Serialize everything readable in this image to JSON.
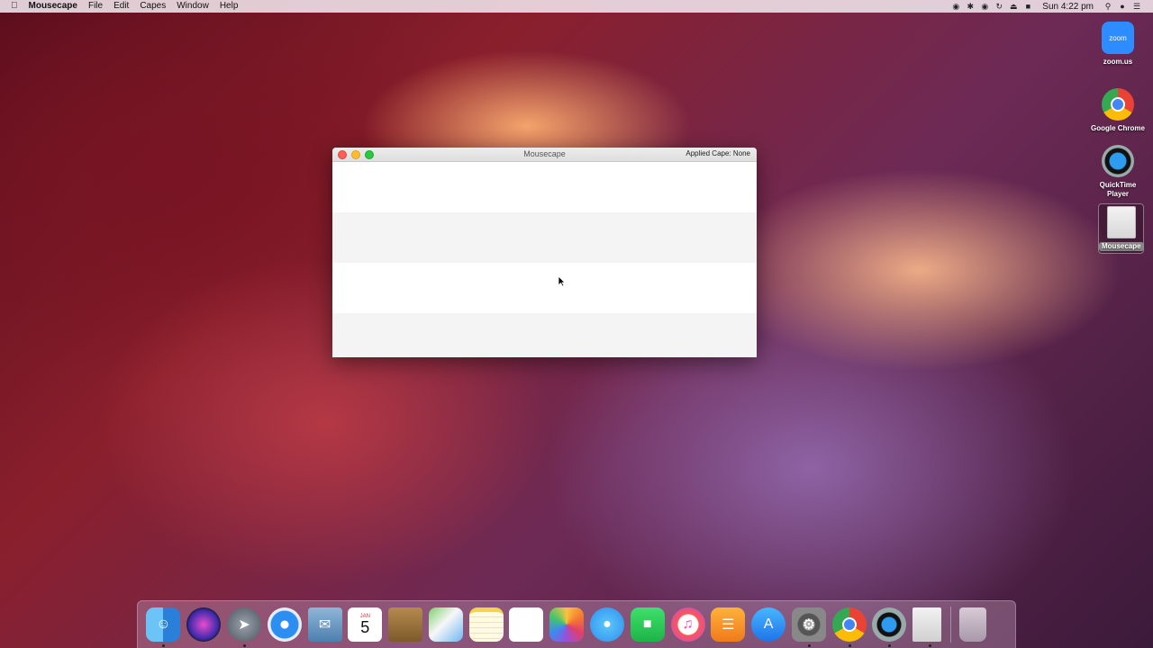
{
  "menubar": {
    "apple": "",
    "app_name": "Mousecape",
    "menus": [
      "File",
      "Edit",
      "Capes",
      "Window",
      "Help"
    ],
    "clock": "Sun 4:22 pm",
    "status_icons": [
      "screen-record-icon",
      "bluetooth-icon",
      "wifi-icon",
      "sync-icon",
      "eject-icon",
      "flag-icon",
      "search-icon",
      "siri-icon",
      "notification-icon"
    ]
  },
  "window": {
    "title": "Mousecape",
    "applied_cape": "Applied Cape: None",
    "row_count": 4
  },
  "desktop_icons": [
    {
      "label": "zoom.us",
      "icon": "zoom-icon",
      "glyph": "zoom"
    },
    {
      "label": "Google Chrome",
      "icon": "chrome-icon"
    },
    {
      "label": "QuickTime Player",
      "icon": "quicktime-icon"
    },
    {
      "label": "Mousecape",
      "icon": "mousecape-icon"
    }
  ],
  "dock": {
    "calendar_month": "JAN",
    "calendar_day": "5",
    "items": [
      "finder",
      "siri",
      "launchpad",
      "safari",
      "mail",
      "calendar",
      "contacts",
      "maps",
      "notes",
      "reminders",
      "photos",
      "messages",
      "facetime",
      "itunes",
      "books",
      "app-store",
      "system-preferences",
      "chrome",
      "quicktime",
      "mousecape",
      "trash"
    ]
  }
}
